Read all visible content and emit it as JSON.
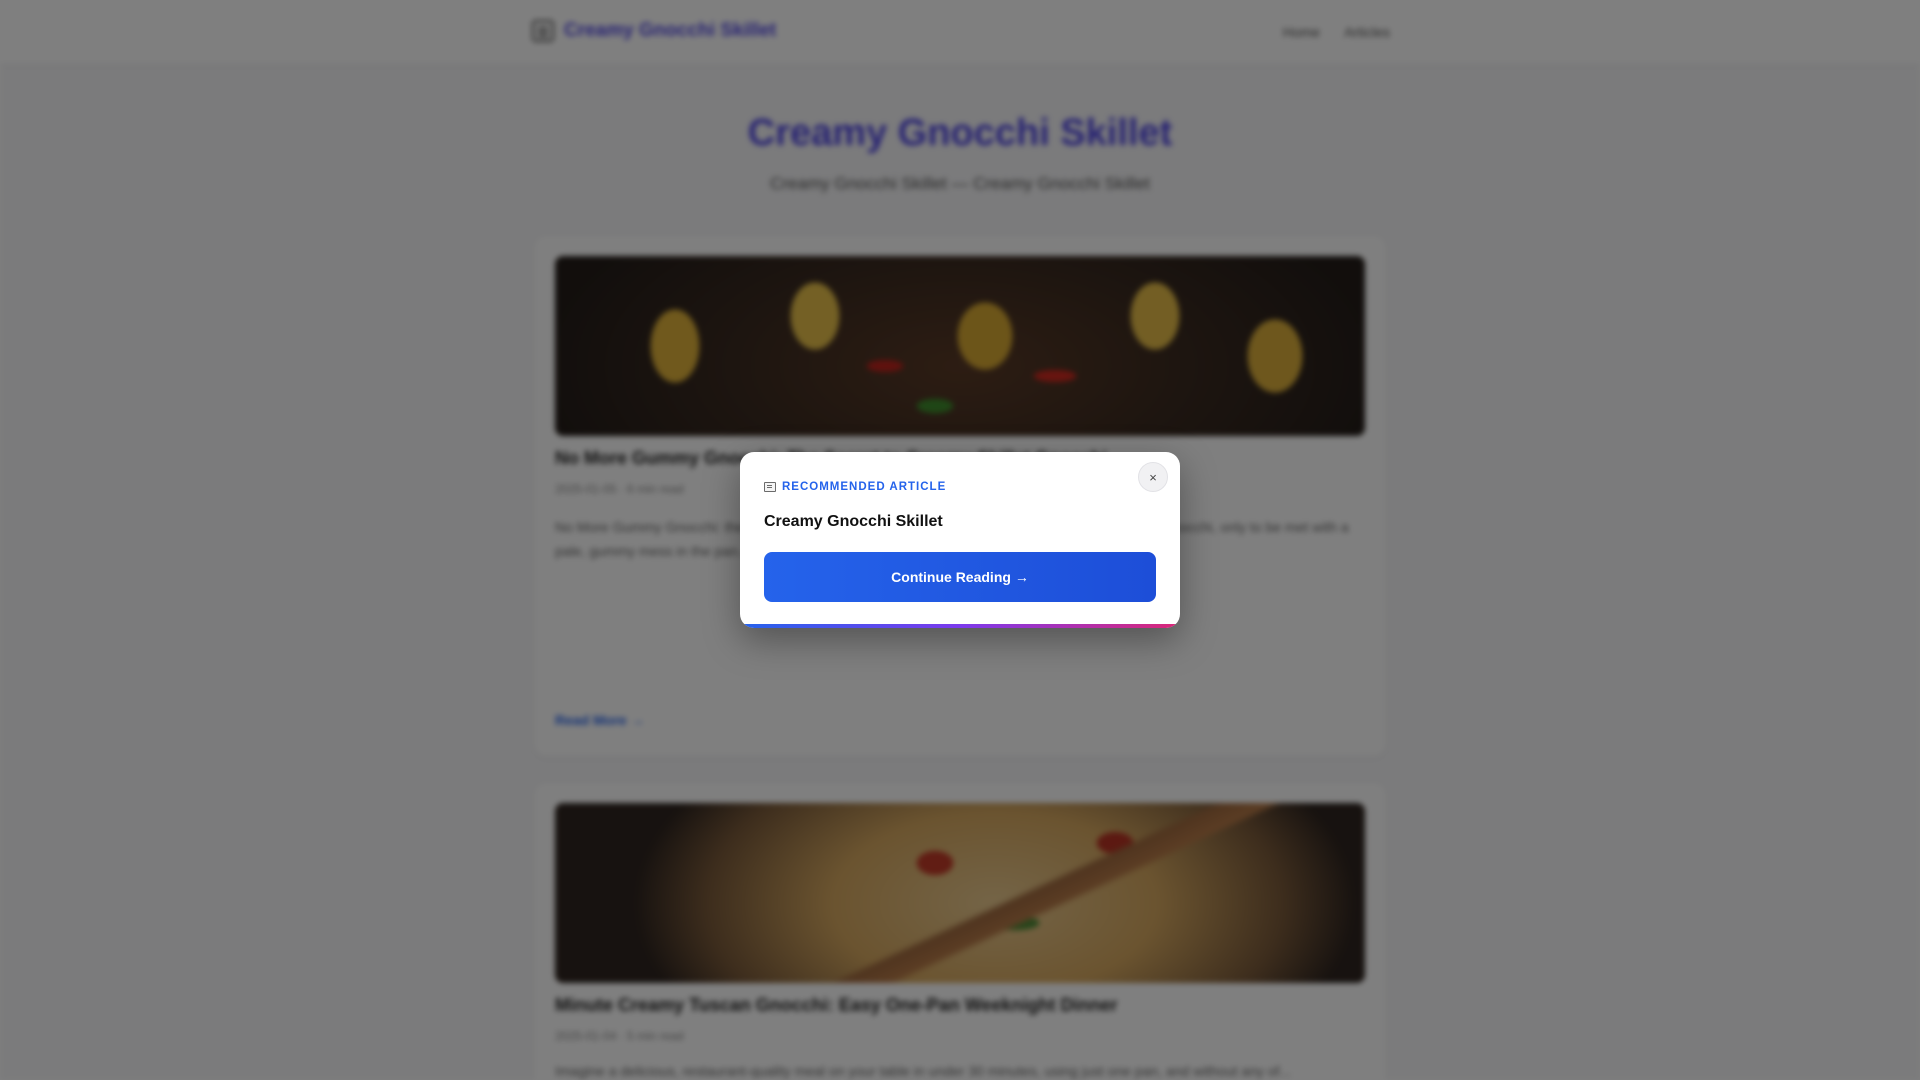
{
  "header": {
    "logo_text": "Creamy Gnocchi Skillet",
    "nav": [
      "Home",
      "Articles"
    ]
  },
  "hero": {
    "title": "Creamy Gnocchi Skillet",
    "subtitle": "Creamy Gnocchi Skillet — Creamy Gnocchi Skillet"
  },
  "articles": [
    {
      "title": "No More Gummy Gnocchi: The Secret to Creamy Skillet Gnocchi",
      "meta": "2025-01-05 · 6 min read",
      "excerpt": "No More Gummy Gnocchi: the one mistake almost everyone makes when they prepare a batch of gnocchi, only to be met with a pale, gummy mess in the pan...",
      "link": "Read More →"
    },
    {
      "title": "Minute Creamy Tuscan Gnocchi: Easy One-Pan Weeknight Dinner",
      "meta": "2025-01-04 · 5 min read",
      "excerpt": "Imagine a delicious, restaurant-quality meal on your table in under 30 minutes, using just one pan, and without any of..."
    }
  ],
  "modal": {
    "label": "RECOMMENDED ARTICLE",
    "title": "Creamy Gnocchi Skillet",
    "button": "Continue Reading →",
    "close": "×"
  },
  "colors": {
    "accent": "#2563eb",
    "brand": "#4f46e5",
    "overlay": "rgba(0,0,0,0.5)"
  },
  "icons": {
    "logo": "newspaper-icon",
    "label": "newspaper-icon",
    "close": "close-icon"
  }
}
